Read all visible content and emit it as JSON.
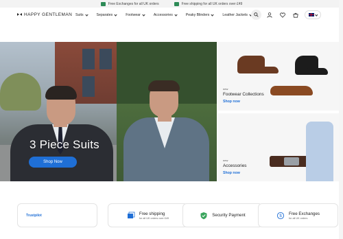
{
  "announcement": {
    "items": [
      {
        "icon": "truck-icon",
        "text": "Free Exchanges for all UK orders"
      },
      {
        "icon": "truck-icon",
        "text": "Free shipping for all UK orders over £49"
      }
    ]
  },
  "header": {
    "logo_text": "HAPPY GENTLEMAN",
    "nav": [
      {
        "label": "Suits"
      },
      {
        "label": "Separates"
      },
      {
        "label": "Footwear"
      },
      {
        "label": "Accessories"
      },
      {
        "label": "Peaky Blinders"
      },
      {
        "label": "Leather Jackets"
      }
    ],
    "icons": [
      "search-icon",
      "user-icon",
      "heart-icon",
      "cart-icon",
      "uk-flag-icon"
    ]
  },
  "hero": {
    "title": "3 Piece Suits",
    "button_label": "Shop Now"
  },
  "promos": [
    {
      "tag": "new",
      "title": "Footwear Collections",
      "link": "Shop now"
    },
    {
      "tag": "new",
      "title": "Accessories",
      "link": "Shop now"
    }
  ],
  "features": [
    {
      "icon": "trustpilot-logo",
      "title": "Trustpilot",
      "subtitle": ""
    },
    {
      "icon": "shipping-box-icon",
      "title": "Free shipping",
      "subtitle": "for all UK orders over £49"
    },
    {
      "icon": "shield-check-icon",
      "title": "Security Payment",
      "subtitle": ""
    },
    {
      "icon": "exchange-icon",
      "title": "Free Exchanges",
      "subtitle": "for all UK orders"
    }
  ],
  "colors": {
    "accent": "#1f6fd6",
    "announcement_icon": "#2e8b57"
  }
}
